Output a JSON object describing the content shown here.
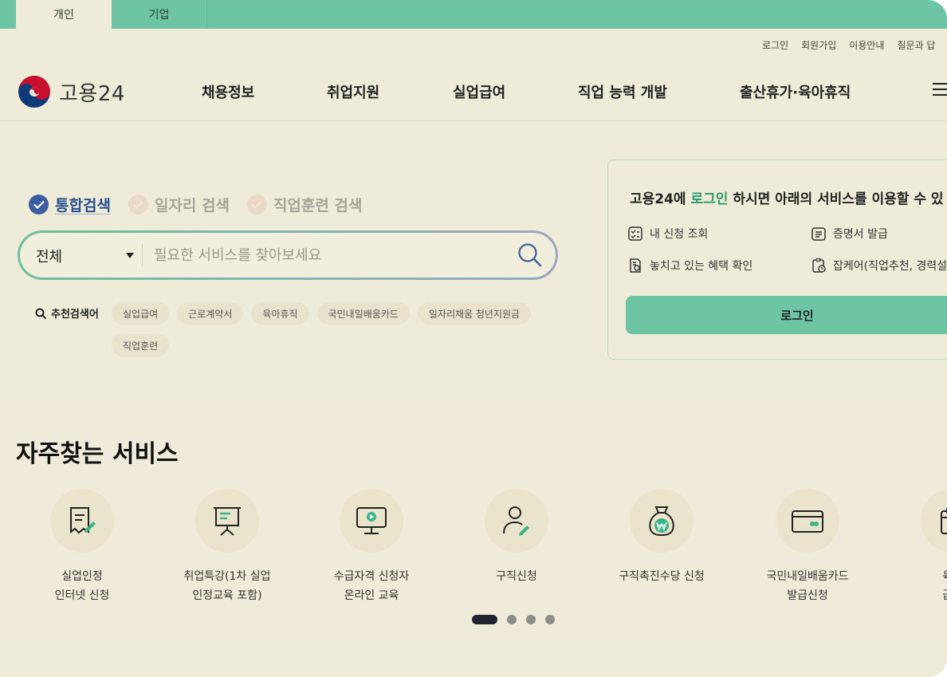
{
  "top_tabs": [
    {
      "label": "개인",
      "active": true
    },
    {
      "label": "기업",
      "active": false
    }
  ],
  "utility_links": [
    "로그인",
    "회원가입",
    "이용안내",
    "질문과 답"
  ],
  "logo": {
    "text": "고용24"
  },
  "gnb": [
    "채용정보",
    "취업지원",
    "실업급여",
    "직업 능력 개발",
    "출산휴가·육아휴직"
  ],
  "search": {
    "tabs": [
      {
        "label": "통합검색",
        "active": true
      },
      {
        "label": "일자리 검색",
        "active": false
      },
      {
        "label": "직업훈련 검색",
        "active": false
      }
    ],
    "category": "전체",
    "placeholder": "필요한 서비스를 찾아보세요",
    "recommend_label": "추천검색어",
    "recommend": [
      "실업급여",
      "근로계약서",
      "육아휴직",
      "국민내일배움카드",
      "일자리채움 청년지원금",
      "직업훈련"
    ]
  },
  "login_card": {
    "title_pre": "고용24에 ",
    "title_highlight": "로그인",
    "title_post": " 하시면 아래의 서비스를 이용할 수 있",
    "items": [
      "내 신청 조회",
      "증명서 발급",
      "놓치고 있는 혜택 확인",
      "잡케어(직업추천, 경력설"
    ],
    "button": "로그인"
  },
  "services": {
    "title": "자주찾는 서비스",
    "items": [
      {
        "label": "실업인정\n인터넷 신청",
        "icon": "document-pen-icon"
      },
      {
        "label": "취업특강(1차 실업\n인정교육 포함)",
        "icon": "presentation-board-icon"
      },
      {
        "label": "수급자격 신청자\n온라인 교육",
        "icon": "monitor-play-icon"
      },
      {
        "label": "구직신청",
        "icon": "person-pen-icon"
      },
      {
        "label": "구직촉진수당 신청",
        "icon": "money-bag-icon"
      },
      {
        "label": "국민내일배움카드\n발급신청",
        "icon": "card-icon"
      },
      {
        "label": "육아\n급여",
        "icon": "calendar-icon"
      }
    ],
    "pagination": {
      "total": 4,
      "current": 1
    }
  },
  "colors": {
    "accent": "#6dc5a3",
    "background": "#efebd9",
    "primary_blue": "#3b5ea0"
  }
}
